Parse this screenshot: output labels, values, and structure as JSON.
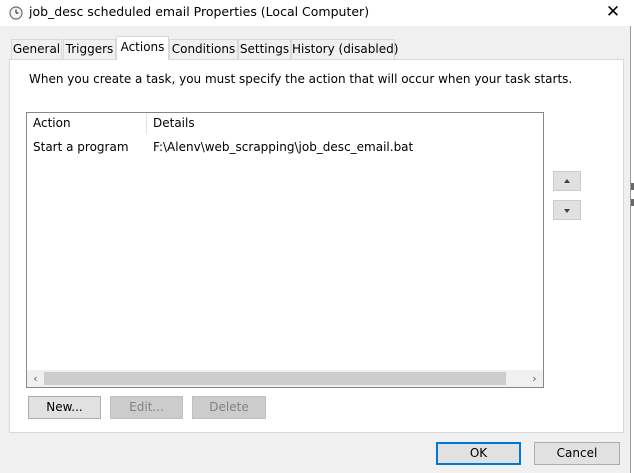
{
  "window": {
    "title": "job_desc scheduled email Properties (Local Computer)",
    "close_glyph": "✕"
  },
  "tabs": [
    {
      "label": "General",
      "active": false
    },
    {
      "label": "Triggers",
      "active": false
    },
    {
      "label": "Actions",
      "active": true
    },
    {
      "label": "Conditions",
      "active": false
    },
    {
      "label": "Settings",
      "active": false
    },
    {
      "label": "History (disabled)",
      "active": false
    }
  ],
  "actions_tab": {
    "description": "When you create a task, you must specify the action that will occur when your task starts.",
    "columns": {
      "action": "Action",
      "details": "Details"
    },
    "rows": [
      {
        "action": "Start a program",
        "details": "F:\\Alenv\\web_scrapping\\job_desc_email.bat"
      }
    ],
    "scroll_left_glyph": "‹",
    "scroll_right_glyph": "›",
    "buttons": {
      "new": "New...",
      "edit": "Edit...",
      "delete": "Delete"
    }
  },
  "footer": {
    "ok": "OK",
    "cancel": "Cancel"
  },
  "colors": {
    "accent": "#0078d7",
    "disabled_text": "#838383",
    "background": "#f0f0f0"
  },
  "icons": {
    "title": "clock-icon",
    "close": "close-icon",
    "move_up": "arrow-up-icon",
    "move_down": "arrow-down-icon"
  }
}
